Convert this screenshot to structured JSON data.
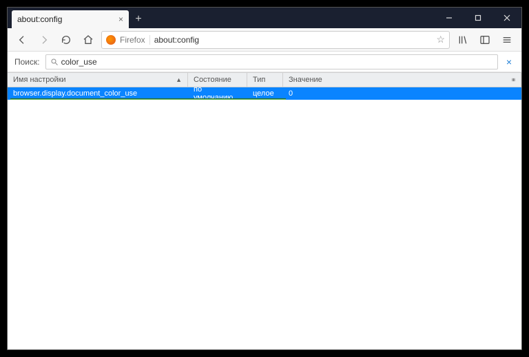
{
  "tab": {
    "title": "about:config"
  },
  "urlbar": {
    "identity": "Firefox",
    "url": "about:config"
  },
  "search": {
    "label": "Поиск:",
    "value": "color_use"
  },
  "columns": {
    "name": "Имя настройки",
    "state": "Состояние",
    "type": "Тип",
    "value": "Значение"
  },
  "rows": [
    {
      "name": "browser.display.document_color_use",
      "state": "по умолчанию",
      "type": "целое",
      "value": "0"
    }
  ]
}
